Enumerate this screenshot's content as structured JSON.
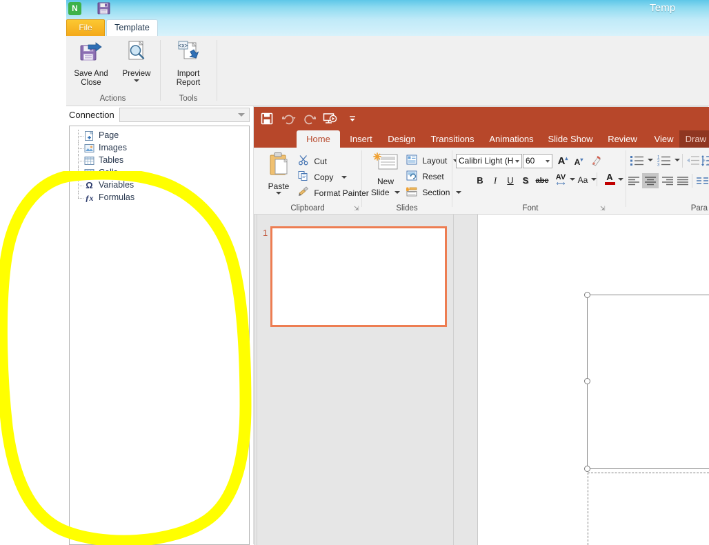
{
  "designer": {
    "title": "Template Designer",
    "title_visible": "Temp",
    "quick_access": [
      {
        "name": "app-logo-icon",
        "glyph": "N"
      },
      {
        "name": "save-icon",
        "glyph": "save"
      }
    ],
    "tabs": [
      {
        "label": "File",
        "active": false
      },
      {
        "label": "Template",
        "active": true
      }
    ],
    "ribbon": {
      "groups": [
        {
          "label": "Actions",
          "buttons": [
            {
              "label_line1": "Save And",
              "label_line2": "Close",
              "icon": "save-and-close-icon",
              "has_dropdown": false
            },
            {
              "label_line1": "Preview",
              "label_line2": "",
              "icon": "preview-magnifier-icon",
              "has_dropdown": true
            }
          ]
        },
        {
          "label": "Tools",
          "buttons": [
            {
              "label_line1": "Import",
              "label_line2": "Report",
              "icon": "import-report-icon",
              "has_dropdown": false
            }
          ]
        }
      ]
    },
    "connection": {
      "label": "Connection",
      "value": "",
      "placeholder": ""
    },
    "tree": {
      "items": [
        {
          "label": "Page",
          "icon": "page-add-icon",
          "selected": false
        },
        {
          "label": "Images",
          "icon": "images-picture-icon",
          "selected": false
        },
        {
          "label": "Tables",
          "icon": "table-grid-icon",
          "selected": false
        },
        {
          "label": "Cells",
          "icon": "cell-grid-icon",
          "selected": true
        },
        {
          "label": "Variables",
          "icon": "omega-variable-icon",
          "selected": false
        },
        {
          "label": "Formulas",
          "icon": "fx-formula-icon",
          "selected": false
        }
      ]
    }
  },
  "powerpoint": {
    "quick_access": [
      {
        "name": "save-icon",
        "glyph": "save"
      },
      {
        "name": "undo-icon",
        "glyph": "undo"
      },
      {
        "name": "redo-icon",
        "glyph": "redo"
      },
      {
        "name": "start-slideshow-icon",
        "glyph": "slideshow"
      },
      {
        "name": "customize-quick-access-icon",
        "glyph": "chevron-down"
      }
    ],
    "tabs": [
      {
        "label": "Home",
        "active": true
      },
      {
        "label": "Insert",
        "active": false
      },
      {
        "label": "Design",
        "active": false
      },
      {
        "label": "Transitions",
        "active": false
      },
      {
        "label": "Animations",
        "active": false
      },
      {
        "label": "Slide Show",
        "active": false
      },
      {
        "label": "Review",
        "active": false
      },
      {
        "label": "View",
        "active": false
      }
    ],
    "contextual_tab": {
      "label": "Drawing Tools",
      "visible_text": "Draw"
    },
    "ribbon": {
      "clipboard": {
        "label": "Clipboard",
        "paste_label": "Paste",
        "cut_label": "Cut",
        "copy_label": "Copy",
        "format_painter_label": "Format Painter"
      },
      "slides": {
        "label": "Slides",
        "new_slide_line1": "New",
        "new_slide_line2": "Slide",
        "layout_label": "Layout",
        "reset_label": "Reset",
        "section_label": "Section"
      },
      "font": {
        "label": "Font",
        "font_name": "Calibri Light (H",
        "font_size": "60",
        "grow_font": "A",
        "shrink_font": "A",
        "clear_formatting": "clear-formatting-icon",
        "bold": "B",
        "italic": "I",
        "underline": "U",
        "shadow": "S",
        "strikethrough": "abc",
        "character_spacing": "AV",
        "change_case": "Aa",
        "font_color": "A"
      },
      "paragraph": {
        "label": "Paragraph",
        "visible_text": "Para",
        "bullets": "bullets-icon",
        "numbering": "numbering-icon",
        "decrease_indent": "decrease-indent-icon",
        "increase_indent": "increase-indent-icon",
        "line_spacing": "line-spacing-icon",
        "align_left": "align-left-icon",
        "align_center": "align-center-icon",
        "align_right": "align-right-icon",
        "justify": "justify-icon",
        "columns": "columns-icon"
      }
    },
    "slides_pane": {
      "slides": [
        {
          "number": "1",
          "selected": true
        }
      ]
    },
    "canvas": {
      "selected_shape": "text-placeholder",
      "handles": 3,
      "secondary_placeholder": "content-placeholder"
    }
  },
  "annotation": {
    "type": "hand-drawn-ellipse",
    "color": "#ffff00",
    "target": "tree-panel-empty-area"
  }
}
